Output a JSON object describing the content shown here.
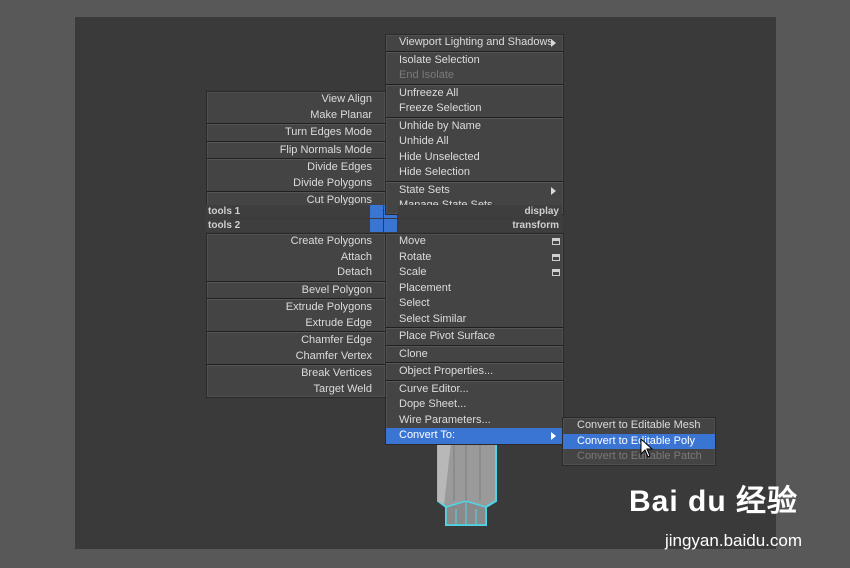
{
  "left_menu": {
    "groups": [
      [
        "View Align",
        "Make Planar"
      ],
      [
        "Turn Edges Mode"
      ],
      [
        "Flip Normals Mode"
      ],
      [
        "Divide Edges",
        "Divide Polygons"
      ],
      [
        "Cut Polygons"
      ]
    ],
    "quad_label_top": "tools 1",
    "quad_label_bottom": "tools 2",
    "groups_lower": [
      [
        "Create Polygons",
        "Attach",
        "Detach"
      ],
      [
        "Bevel Polygon"
      ],
      [
        "Extrude Polygons",
        "Extrude Edge"
      ],
      [
        "Chamfer Edge",
        "Chamfer Vertex"
      ],
      [
        "Break Vertices",
        "Target Weld"
      ]
    ]
  },
  "right_menu": {
    "items_upper": {
      "viewport_lighting": "Viewport Lighting and Shadows",
      "isolate_selection": "Isolate Selection",
      "end_isolate": "End Isolate",
      "unfreeze_all": "Unfreeze All",
      "freeze_selection": "Freeze Selection",
      "unhide_by_name": "Unhide by Name",
      "unhide_all": "Unhide All",
      "hide_unselected": "Hide Unselected",
      "hide_selection": "Hide Selection",
      "state_sets": "State Sets",
      "manage_state_sets": "Manage State Sets..."
    },
    "quad_label_top": "display",
    "quad_label_bottom": "transform",
    "items_lower": {
      "move": "Move",
      "rotate": "Rotate",
      "scale": "Scale",
      "placement": "Placement",
      "select": "Select",
      "select_similar": "Select Similar",
      "place_pivot_surface": "Place Pivot Surface",
      "clone": "Clone",
      "object_properties": "Object Properties...",
      "curve_editor": "Curve Editor...",
      "dope_sheet": "Dope Sheet...",
      "wire_parameters": "Wire Parameters...",
      "convert_to": "Convert To:"
    }
  },
  "submenu": {
    "items": [
      "Convert to Editable Mesh",
      "Convert to Editable Poly",
      "Convert to Editable Patch"
    ],
    "selected_index": 1,
    "disabled_index": 2
  },
  "watermark": {
    "logo": "Bai du 经验",
    "url": "jingyan.baidu.com"
  },
  "colors": {
    "highlight": "#3b75d4",
    "menu_bg": "#444444",
    "viewport_bg": "#3a3a3a",
    "object_outline": "#4fd6e8"
  }
}
